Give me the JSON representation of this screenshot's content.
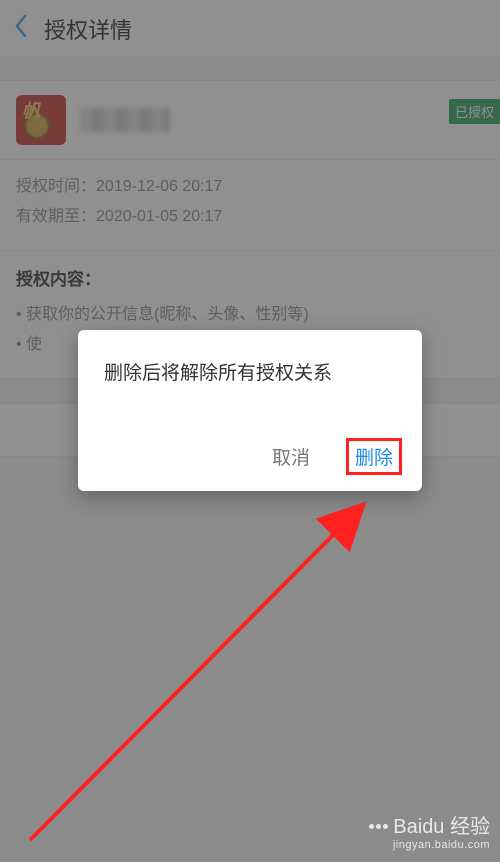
{
  "header": {
    "title": "授权详情"
  },
  "app": {
    "status_badge": "已授权"
  },
  "meta": {
    "auth_time_label": "授权时间：",
    "auth_time_value": "2019-12-06 20:17",
    "valid_until_label": "有效期至：",
    "valid_until_value": "2020-01-05 20:17"
  },
  "content": {
    "heading": "授权内容：",
    "items": [
      "获取你的公开信息(昵称、头像、性别等)",
      "使"
    ]
  },
  "dialog": {
    "message": "删除后将解除所有授权关系",
    "cancel": "取消",
    "delete": "删除"
  },
  "watermark": {
    "main": "Baidu 经验",
    "sub": "jingyan.baidu.com"
  }
}
